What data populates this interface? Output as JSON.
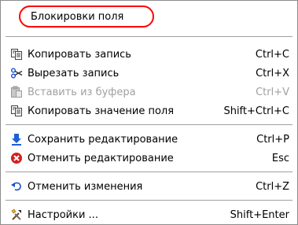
{
  "menu": {
    "header": {
      "label": "Блокировки поля"
    },
    "items": [
      {
        "label": "Копировать запись",
        "shortcut": "Ctrl+C",
        "icon": "copy-record-icon",
        "disabled": false
      },
      {
        "label": "Вырезать запись",
        "shortcut": "Ctrl+X",
        "icon": "scissors-icon",
        "disabled": false
      },
      {
        "label": "Вставить из буфера",
        "shortcut": "Ctrl+V",
        "icon": "paste-icon",
        "disabled": true
      },
      {
        "label": "Копировать значение поля",
        "shortcut": "Shift+Ctrl+C",
        "icon": "copy-field-icon",
        "disabled": false
      },
      {
        "label": "Сохранить редактирование",
        "shortcut": "Ctrl+P",
        "icon": "save-arrow-icon",
        "disabled": false
      },
      {
        "label": "Отменить редактирование",
        "shortcut": "Esc",
        "icon": "cancel-icon",
        "disabled": false
      },
      {
        "label": "Отменить изменения",
        "shortcut": "Ctrl+Z",
        "icon": "undo-icon",
        "disabled": false
      },
      {
        "label": "Настройки ...",
        "shortcut": "Shift+Enter",
        "icon": "settings-tools-icon",
        "disabled": false
      }
    ]
  },
  "colors": {
    "highlight": "#ff0000",
    "disabled_text": "#a0a0a0",
    "save_icon": "#1f5fd6",
    "cancel_icon": "#d32020"
  }
}
